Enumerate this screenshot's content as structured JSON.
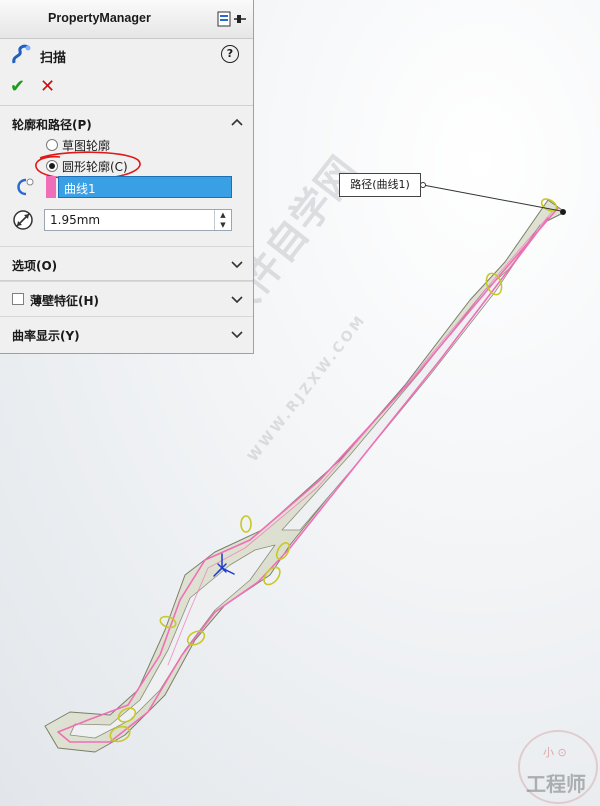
{
  "panel": {
    "title": "PropertyManager",
    "feature_name": "扫描",
    "help_label": "?",
    "ok_label": "✔",
    "cancel_label": "✕"
  },
  "profile_path_section": {
    "label": "轮廓和路径(P)",
    "options": [
      "草图轮廓",
      "圆形轮廓(C)"
    ],
    "selected_option": "圆形轮廓(C)",
    "path_selection": "曲线1",
    "diameter": "1.95mm"
  },
  "collapsed_sections": {
    "options": "选项(O)",
    "thin_feature": "薄壁特征(H)",
    "curvature_display": "曲率显示(Y)"
  },
  "callout": {
    "text": "路径(曲线1)"
  },
  "watermark": {
    "text": "软件自学网",
    "url_text": "WWW.RJZXW.COM"
  },
  "logo": {
    "small_text": "小 ⊙",
    "text": "工程师"
  },
  "colors": {
    "accent_selection": "#3aa0e6",
    "path_color": "#f06eb8",
    "ok": "#1b9e1b",
    "cancel": "#d01010",
    "annotation_red": "#e01818"
  }
}
